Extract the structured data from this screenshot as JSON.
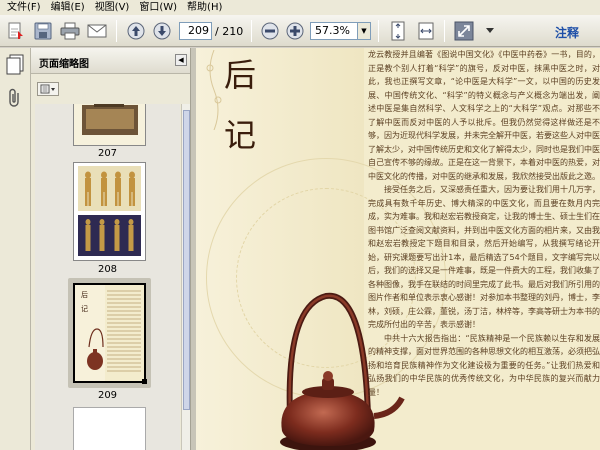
{
  "menu": [
    "文件(F)",
    "编辑(E)",
    "视图(V)",
    "窗口(W)",
    "帮助(H)"
  ],
  "toolbar": {
    "current_page": "209",
    "total_pages": "/ 210",
    "zoom": "57.3%",
    "annotate_label": "注释"
  },
  "thumbnails": {
    "title": "页面缩略图",
    "pages": [
      "207",
      "208",
      "209"
    ]
  },
  "document": {
    "heading_1": "后",
    "heading_2": "记",
    "paragraphs": [
      "龙云教授并且编著《图说中国文化》《中医中药卷》一书，目的，正是教个别人打着“科学”的旗号，反对中医，抹黑中医之时，对此，我也正撰写文章，“论中医是大科学”一文，以中国的历史发展、中国传统文化、“科学”的特义概念与产义概念为端出发，阐述中医是集自然科学、人文科学之上的“大科学”观点。对那些不了解中医而反对中医的人予以批斥。但我仍然觉得这样做还是不够，因为近现代科学发展，并未完全解开中医，若要这些人对中医了解太少，对中国传统历史和文化了解得太少，同时也是我们中医自己宣传不够的缘故。正是在这一背景下，本着对中医的热爱，对中医文化的传播，对中医的继承和发展，我欣然接受出版此之邀。",
      "接受任务之后，又深感责任重大，因为要让我们用十几万字，完成具有数千年历史、博大精深的中医文化，而且要在数月内完成，实为难事。我和赵宏岩教授商定，让我的博士生、硕士生们在图书馆广泛查阅文献资料，并到出中医文化方面的相片来，又由我和赵宏岩教授定下题目和目录，然后开始编写，从我撰写绪论开始，研究课题要写出计1本，最后精选了54个题目，文字编写完以后，我们的选择又是一件难事，既是一件费大的工程，我们收集了各种图像，我手在联结的时间里完成了此书。最后对我们所引用的图片作者和单位表示衷心感谢！对参加本书整理的刘丹，博士，李林，刘硕，庄公霖，董锐，汤丁洁，林梓等，李高等研士为本书的完成所付出的辛苦，表示感谢！",
      "中共十六大报告指出：“民族精神是一个民族赖以生存和发展的精神支撑，面对世界范围的各种思想文化的相互激荡，必须把弘扬和培育民族精神作为文化建设极为重要的任务。”让我们热爱和弘扬我们的中华民族的优秀传统文化，为中华民族的复兴而献力量！"
    ]
  },
  "icons": {
    "toolbar": [
      "create-pdf-icon",
      "save-icon",
      "print-icon",
      "email-icon",
      "prev-page-icon",
      "next-page-icon",
      "zoom-out-icon",
      "zoom-in-icon",
      "fit-page-icon",
      "fit-width-icon",
      "expand-icon",
      "dropdown-arrow-icon"
    ],
    "left": [
      "pages-icon",
      "paperclip-icon",
      "options-icon",
      "collapse-icon"
    ]
  },
  "colors": {
    "annotate": "#1e4fa8",
    "page_bg": "#f3eccd",
    "heading": "#3a1d0c",
    "body_text": "#5b3f22"
  }
}
